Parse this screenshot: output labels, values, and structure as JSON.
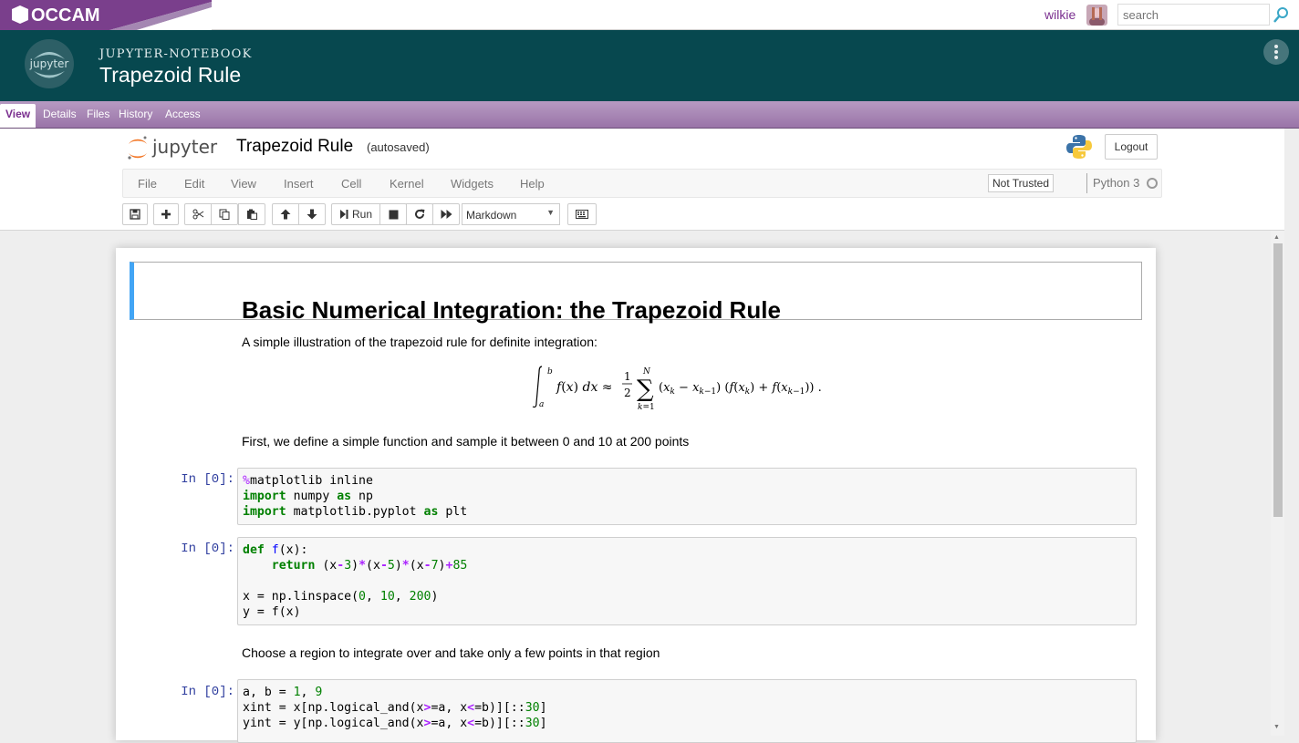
{
  "topbar": {
    "brand": "OCCAM",
    "user": "wilkie",
    "search_placeholder": "search"
  },
  "header": {
    "kind": "JUPYTER-NOTEBOOK",
    "title": "Trapezoid Rule"
  },
  "object_tabs": [
    "View",
    "Details",
    "Files",
    "History",
    "Access"
  ],
  "notebook": {
    "logo_text": "jupyter",
    "name": "Trapezoid Rule",
    "save_status": "(autosaved)",
    "logout_label": "Logout",
    "menu": [
      "File",
      "Edit",
      "View",
      "Insert",
      "Cell",
      "Kernel",
      "Widgets",
      "Help"
    ],
    "trust_label": "Not Trusted",
    "kernel_name": "Python 3",
    "run_label": "Run",
    "cell_type": "Markdown"
  },
  "cells": {
    "heading": "Basic Numerical Integration: the Trapezoid Rule",
    "intro": "A simple illustration of the trapezoid rule for definite integration:",
    "text1": "First, we define a simple function and sample it between 0 and 10 at 200 points",
    "text2": "Choose a region to integrate over and take only a few points in that region",
    "prompts": [
      "In [0]:",
      "In [0]:",
      "In [0]:"
    ]
  },
  "colors": {
    "header_bg": "#07484f",
    "tabs_bg": "#a985b5",
    "accent": "#7a2f8f",
    "cell_border_selected": "#42a5f5"
  }
}
